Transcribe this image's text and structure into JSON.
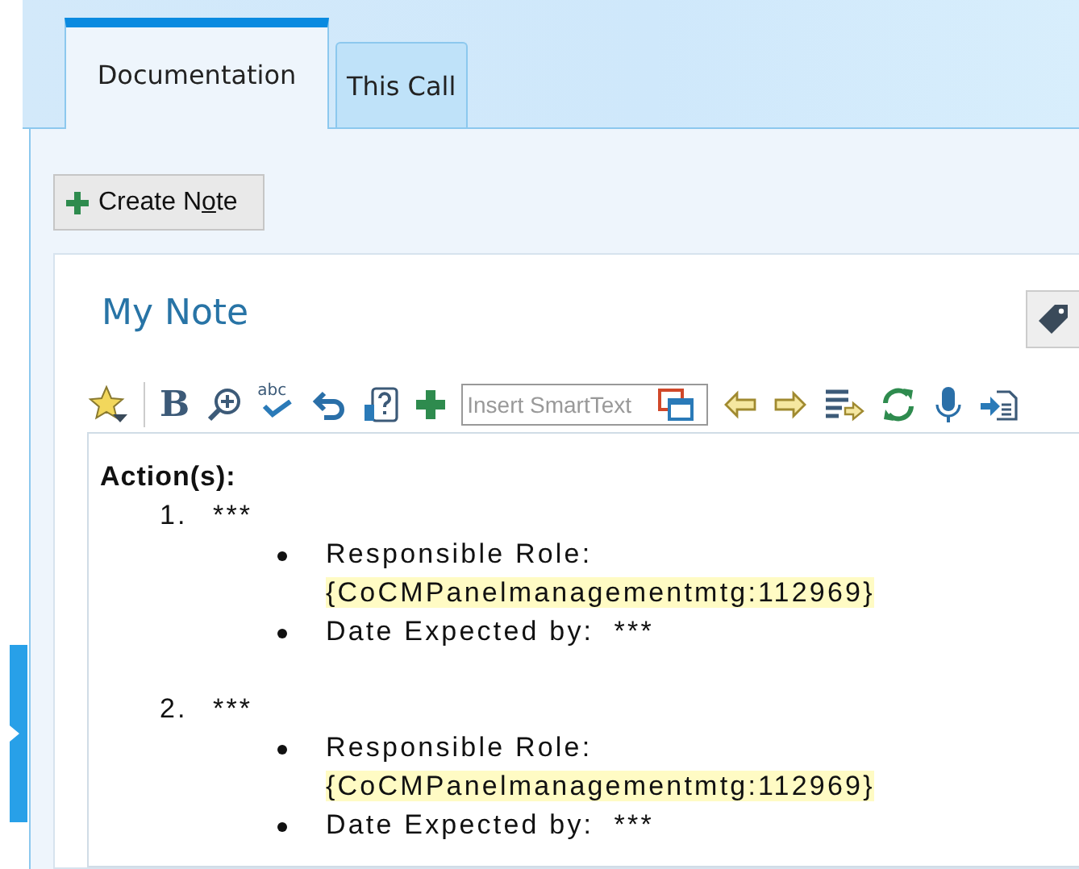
{
  "tabs": [
    {
      "label": "Documentation",
      "selected": true
    },
    {
      "label": "This Call",
      "selected": false
    }
  ],
  "create_note_button": {
    "label_parts": [
      {
        "text": "Create N",
        "underlined": false
      },
      {
        "text": "o",
        "underlined": true
      },
      {
        "text": "te",
        "underlined": false
      }
    ]
  },
  "note": {
    "title": "My Note",
    "toolbar": {
      "bold_label": "B",
      "spellcheck_label": "abc",
      "smarttext": {
        "placeholder": "Insert SmartText"
      }
    },
    "body": {
      "heading": "Action(s):",
      "actions": [
        {
          "number": "1.",
          "text": "***",
          "details": [
            {
              "label": "Responsible Role:",
              "value": "{CoCMPanelmanagementmtg:112969}",
              "highlighted": true
            },
            {
              "label": "Date Expected by:",
              "value": "***",
              "highlighted": false
            }
          ]
        },
        {
          "number": "2.",
          "text": "***",
          "details": [
            {
              "label": "Responsible Role:",
              "value": "{CoCMPanelmanagementmtg:112969}",
              "highlighted": true
            },
            {
              "label": "Date Expected by:",
              "value": "***",
              "highlighted": false
            }
          ]
        }
      ]
    }
  }
}
